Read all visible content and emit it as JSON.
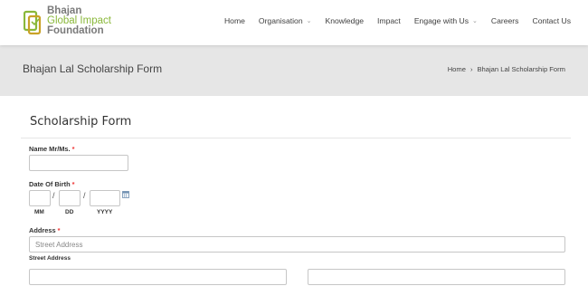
{
  "logo": {
    "line1": "Bhajan",
    "line2": "Global Impact",
    "line3": "Foundation"
  },
  "nav": [
    {
      "label": "Home",
      "dropdown": false
    },
    {
      "label": "Organisation",
      "dropdown": true
    },
    {
      "label": "Knowledge",
      "dropdown": false
    },
    {
      "label": "Impact",
      "dropdown": false
    },
    {
      "label": "Engage with Us",
      "dropdown": true
    },
    {
      "label": "Careers",
      "dropdown": false
    },
    {
      "label": "Contact Us",
      "dropdown": false
    }
  ],
  "banner": {
    "title": "Bhajan Lal Scholarship Form",
    "breadcrumb": {
      "home": "Home",
      "separator": "›",
      "current": "Bhajan Lal Scholarship Form"
    }
  },
  "form": {
    "title": "Scholarship Form",
    "name": {
      "label": "Name Mr/Ms.",
      "required": "*",
      "value": ""
    },
    "dob": {
      "label": "Date Of Birth",
      "required": "*",
      "separator": "/",
      "mm_label": "MM",
      "dd_label": "DD",
      "yyyy_label": "YYYY"
    },
    "address": {
      "label": "Address",
      "required": "*",
      "street_placeholder": "Street Address",
      "street_sublabel": "Street Address"
    }
  },
  "colors": {
    "accent_green": "#8ab83a",
    "required_red": "#e33333",
    "banner_bg": "#e6e6e6"
  }
}
